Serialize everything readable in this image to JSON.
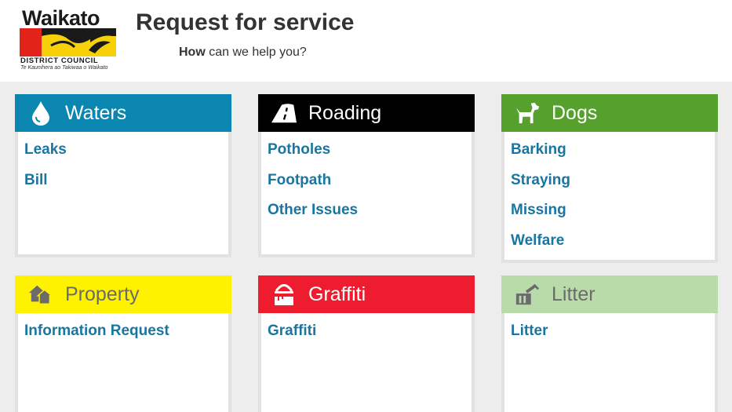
{
  "logo": {
    "name": "Waikato",
    "council": "DISTRICT COUNCIL",
    "tagline": "Te Kaunihera ao Takiwaa o Waikato"
  },
  "header": {
    "title_bold": "Request",
    "title_rest": " for service",
    "subtitle_bold": "How",
    "subtitle_rest": " can we help you?"
  },
  "categories": [
    {
      "title": "Waters",
      "icon": "water-drop-icon",
      "color": "#0b86b0",
      "text_color": "#ffffff",
      "links": [
        "Leaks",
        "Bill"
      ]
    },
    {
      "title": "Roading",
      "icon": "road-icon",
      "color": "#000000",
      "text_color": "#ffffff",
      "links": [
        "Potholes",
        "Footpath",
        "Other Issues"
      ]
    },
    {
      "title": "Dogs",
      "icon": "dog-icon",
      "color": "#56a12e",
      "text_color": "#ffffff",
      "links": [
        "Barking",
        "Straying",
        "Missing",
        "Welfare"
      ]
    },
    {
      "title": "Property",
      "icon": "house-icon",
      "color": "#fff200",
      "text_color": "#6b6b6b",
      "links": [
        "Information Request"
      ]
    },
    {
      "title": "Graffiti",
      "icon": "paint-can-icon",
      "color": "#ed1c2e",
      "text_color": "#ffffff",
      "links": [
        "Graffiti"
      ]
    },
    {
      "title": "Litter",
      "icon": "litter-bin-icon",
      "color": "#b9dbaa",
      "text_color": "#6b6b6b",
      "links": [
        "Litter"
      ]
    }
  ]
}
